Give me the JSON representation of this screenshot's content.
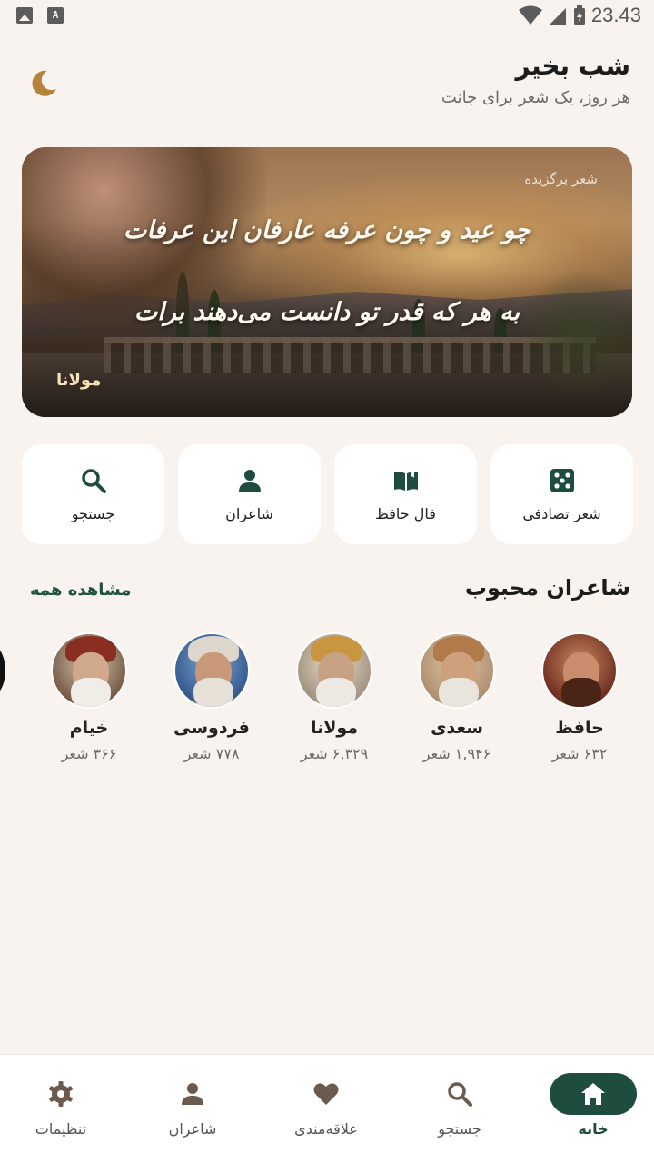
{
  "status_bar": {
    "time": "23.43"
  },
  "header": {
    "greeting": "شب بخیر",
    "subtitle": "هر روز، یک شعر برای جانت",
    "theme_icon": "moon-icon"
  },
  "featured": {
    "label": "شعر برگزیده",
    "verse_1": "چو عید و چون عرفه عارفان این عرفات",
    "verse_2": "به هر که قدر تو دانست می‌دهند برات",
    "poet": "مولانا"
  },
  "actions": [
    {
      "label": "شعر تصادفی",
      "icon": "dice-icon"
    },
    {
      "label": "فال حافظ",
      "icon": "book-open-icon"
    },
    {
      "label": "شاعران",
      "icon": "person-icon"
    },
    {
      "label": "جستجو",
      "icon": "search-icon"
    }
  ],
  "poets_section": {
    "title": "شاعران محبوب",
    "see_all": "مشاهده همه",
    "poets": [
      {
        "name": "حافظ",
        "count": "۶۳۲ شعر"
      },
      {
        "name": "سعدی",
        "count": "۱,۹۴۶ شعر"
      },
      {
        "name": "مولانا",
        "count": "۶,۳۲۹ شعر"
      },
      {
        "name": "فردوسی",
        "count": "۷۷۸ شعر"
      },
      {
        "name": "خیام",
        "count": "۳۶۶ شعر"
      }
    ]
  },
  "bottom_nav": [
    {
      "label": "خانه",
      "icon": "home-icon",
      "active": true
    },
    {
      "label": "جستجو",
      "icon": "search-icon",
      "active": false
    },
    {
      "label": "علاقه‌مندی",
      "icon": "heart-icon",
      "active": false
    },
    {
      "label": "شاعران",
      "icon": "person-icon",
      "active": false
    },
    {
      "label": "تنظیمات",
      "icon": "gear-icon",
      "active": false
    }
  ],
  "colors": {
    "accent": "#1e4d40",
    "background": "#f8f3ee",
    "moon": "#b5823a"
  }
}
